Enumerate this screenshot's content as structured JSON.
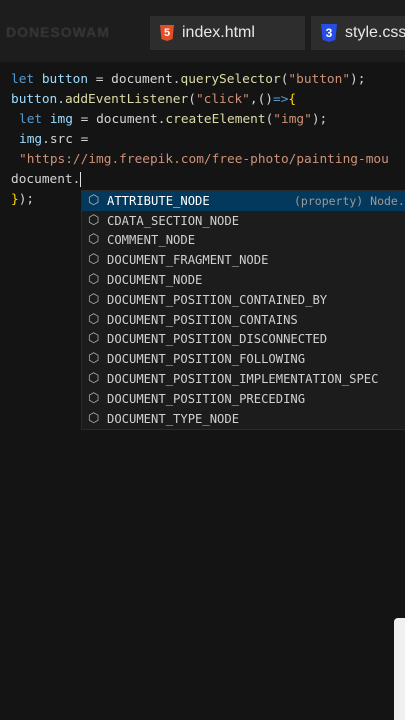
{
  "sidebar": {
    "title": "DONESOWAM"
  },
  "tabs": [
    {
      "label": "index.html",
      "icon": "html5-icon"
    },
    {
      "label": "style.css",
      "icon": "css3-icon"
    }
  ],
  "code": {
    "l1": {
      "kw": "let",
      "var": " button",
      "rest": " = document.",
      "fn": "querySelector",
      "p1": "(",
      "str": "\"button\"",
      "p2": ");"
    },
    "l2": {
      "var": "button.",
      "fn": "addEventListener",
      "p1": "(",
      "str": "\"click\"",
      "p2": ",()",
      "kw": "=>",
      "brace": "{"
    },
    "l3": {
      "kw": "let",
      "var": " img",
      "rest": " = document.",
      "fn": "createElement",
      "p1": "(",
      "str": "\"img\"",
      "p2": ");"
    },
    "l4": {
      "var": "img",
      "rest": ".src ="
    },
    "l5": {
      "str": "\"https://img.freepik.com/free-photo/painting-mou"
    },
    "l6": {
      "text": "document."
    },
    "l7": {
      "brace": "}",
      "rest": ");"
    }
  },
  "suggestions": {
    "detail": "(property) Node.",
    "items": [
      "ATTRIBUTE_NODE",
      "CDATA_SECTION_NODE",
      "COMMENT_NODE",
      "DOCUMENT_FRAGMENT_NODE",
      "DOCUMENT_NODE",
      "DOCUMENT_POSITION_CONTAINED_BY",
      "DOCUMENT_POSITION_CONTAINS",
      "DOCUMENT_POSITION_DISCONNECTED",
      "DOCUMENT_POSITION_FOLLOWING",
      "DOCUMENT_POSITION_IMPLEMENTATION_SPEC",
      "DOCUMENT_POSITION_PRECEDING",
      "DOCUMENT_TYPE_NODE"
    ]
  }
}
